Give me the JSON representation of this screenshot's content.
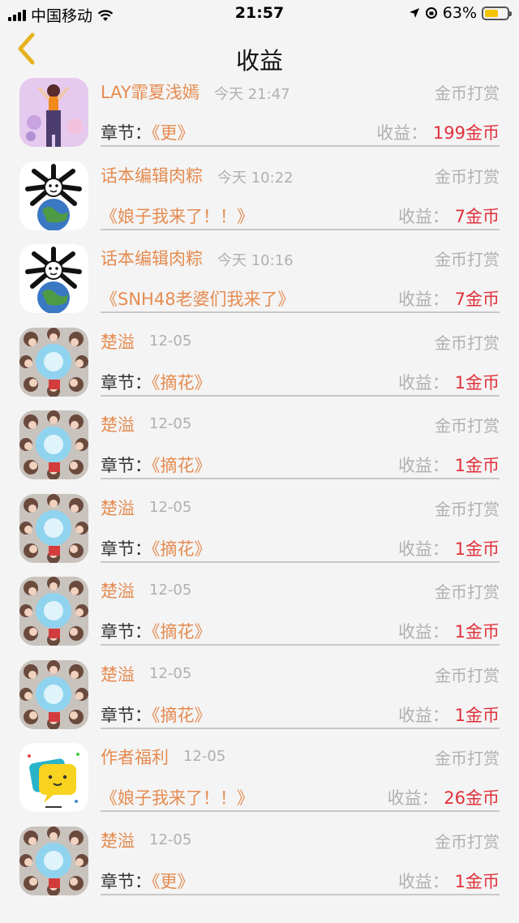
{
  "status_bar": {
    "carrier": "中国移动",
    "time": "21:57",
    "battery": "63%",
    "battery_level": 0.63
  },
  "nav": {
    "title": "收益"
  },
  "labels": {
    "chapter": "章节：",
    "earnings": "收益："
  },
  "rows": [
    {
      "avatar": "lay-photo",
      "name": "LAY霏夏浅嫣",
      "time": "今天 21:47",
      "type": "金币打赏",
      "chapter_label": "章节：",
      "chapter": "《更》",
      "amount": "199金币"
    },
    {
      "avatar": "cartoon-face-earth",
      "name": "话本编辑肉粽",
      "time": "今天 10:22",
      "type": "金币打赏",
      "chapter_label": "",
      "chapter": "《娘子我来了！！》",
      "amount": "7金币"
    },
    {
      "avatar": "cartoon-face-earth",
      "name": "话本编辑肉粽",
      "time": "今天 10:16",
      "type": "金币打赏",
      "chapter_label": "",
      "chapter": "《SNH48老婆们我来了》",
      "amount": "7金币"
    },
    {
      "avatar": "group-circle",
      "name": "楚溢",
      "time": "12-05",
      "type": "金币打赏",
      "chapter_label": "章节：",
      "chapter": "《摘花》",
      "amount": "1金币"
    },
    {
      "avatar": "group-circle",
      "name": "楚溢",
      "time": "12-05",
      "type": "金币打赏",
      "chapter_label": "章节：",
      "chapter": "《摘花》",
      "amount": "1金币"
    },
    {
      "avatar": "group-circle",
      "name": "楚溢",
      "time": "12-05",
      "type": "金币打赏",
      "chapter_label": "章节：",
      "chapter": "《摘花》",
      "amount": "1金币"
    },
    {
      "avatar": "group-circle",
      "name": "楚溢",
      "time": "12-05",
      "type": "金币打赏",
      "chapter_label": "章节：",
      "chapter": "《摘花》",
      "amount": "1金币"
    },
    {
      "avatar": "group-circle",
      "name": "楚溢",
      "time": "12-05",
      "type": "金币打赏",
      "chapter_label": "章节：",
      "chapter": "《摘花》",
      "amount": "1金币"
    },
    {
      "avatar": "chat-bubble-logo",
      "name": "作者福利",
      "time": "12-05",
      "type": "金币打赏",
      "chapter_label": "",
      "chapter": "《娘子我来了！！》",
      "amount": "26金币"
    },
    {
      "avatar": "group-circle",
      "name": "楚溢",
      "time": "12-05",
      "type": "金币打赏",
      "chapter_label": "章节：",
      "chapter": "《更》",
      "amount": "1金币"
    }
  ],
  "colors": {
    "accent": "#e58b50",
    "amount": "#e0303a",
    "muted": "#b0b0b0",
    "background": "#f4f4f4",
    "back_arrow": "#e6b21e"
  }
}
